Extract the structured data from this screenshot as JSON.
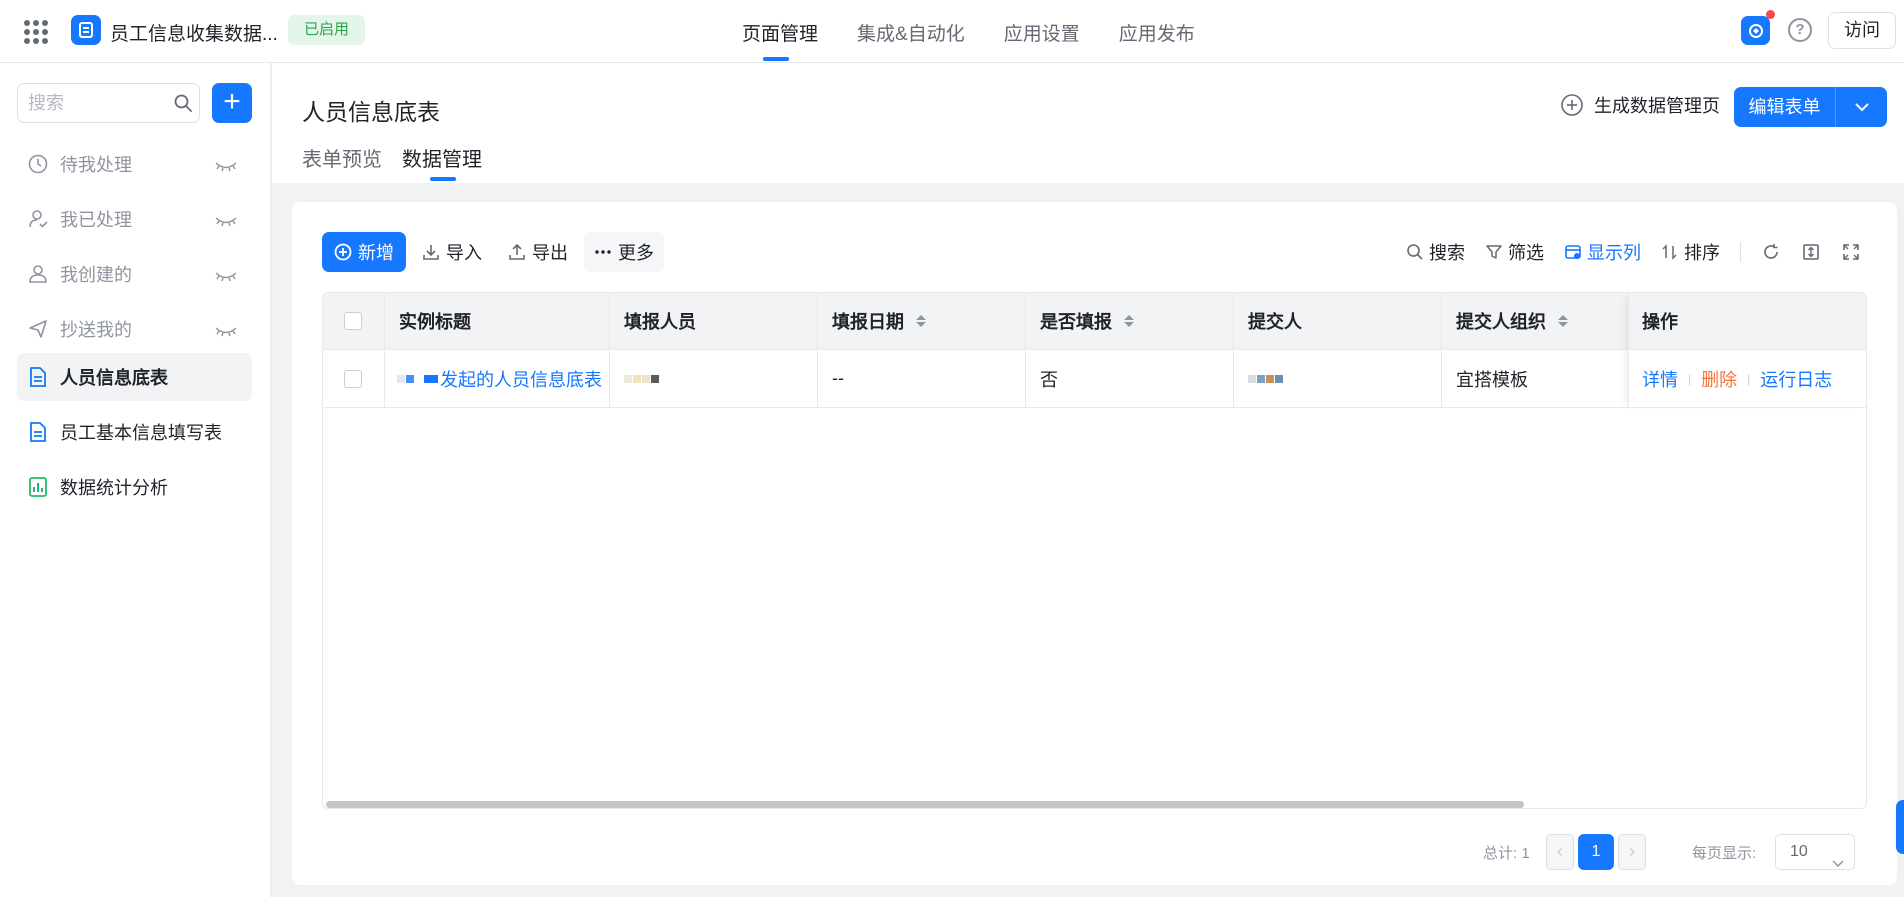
{
  "header": {
    "app_title": "员工信息收集数据...",
    "status_badge": "已启用",
    "nav": [
      "页面管理",
      "集成&自动化",
      "应用设置",
      "应用发布"
    ],
    "visit_label": "访问",
    "help_glyph": "?"
  },
  "sidebar": {
    "search_placeholder": "搜索",
    "add_label": "+",
    "items": [
      {
        "label": "待我处理",
        "icon": "clock-icon"
      },
      {
        "label": "我已处理",
        "icon": "user-check-icon"
      },
      {
        "label": "我创建的",
        "icon": "user-icon"
      },
      {
        "label": "抄送我的",
        "icon": "send-icon"
      },
      {
        "label": "人员信息底表",
        "icon": "doc-icon"
      },
      {
        "label": "员工基本信息填写表",
        "icon": "doc-icon"
      },
      {
        "label": "数据统计分析",
        "icon": "chart-icon"
      }
    ]
  },
  "page": {
    "title": "人员信息底表",
    "generate_label": "生成数据管理页",
    "edit_label": "编辑表单",
    "tabs": [
      "表单预览",
      "数据管理"
    ]
  },
  "toolbar": {
    "add": "新增",
    "import": "导入",
    "export": "导出",
    "more": "更多",
    "search": "搜索",
    "filter": "筛选",
    "columns": "显示列",
    "sort": "排序"
  },
  "table": {
    "headers": [
      "实例标题",
      "填报人员",
      "填报日期",
      "是否填报",
      "提交人",
      "提交人组织",
      "操作"
    ],
    "rows": [
      {
        "title": "发起的人员信息底表",
        "date": "--",
        "filled": "否",
        "org": "宜搭模板",
        "actions": [
          "详情",
          "删除",
          "运行日志"
        ]
      }
    ]
  },
  "pagination": {
    "total": "总计: 1",
    "prev": "‹",
    "next": "›",
    "current": "1",
    "per_page_label": "每页显示:",
    "per_page": "10"
  },
  "colors": {
    "accent": "#1677ff",
    "danger_link": "#f5743a",
    "badge_bg": "#e3f6e9",
    "badge_text": "#2aa44f"
  }
}
